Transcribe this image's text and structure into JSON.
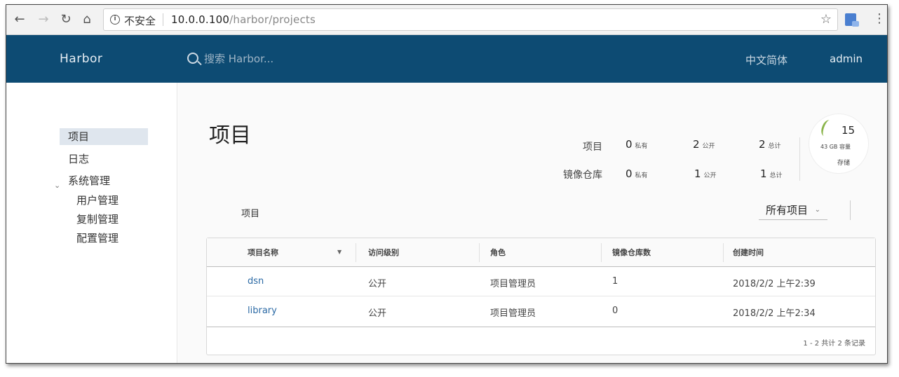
{
  "browser": {
    "insecure_label": "不安全",
    "url_host": "10.0.0.100",
    "url_path": "/harbor/projects"
  },
  "header": {
    "brand": "Harbor",
    "search_placeholder": "搜索 Harbor...",
    "language": "中文简体",
    "user": "admin",
    "bg_color": "#0d4b73"
  },
  "sidebar": {
    "items": [
      {
        "label": "项目",
        "active": true
      },
      {
        "label": "日志"
      },
      {
        "label": "系统管理",
        "expanded": true
      },
      {
        "label": "用户管理"
      },
      {
        "label": "复制管理"
      },
      {
        "label": "配置管理"
      }
    ]
  },
  "main": {
    "title": "项目",
    "stats": {
      "projects_label": "项目",
      "repos_label": "镜像仓库",
      "projects": {
        "private": "0",
        "public": "2",
        "total": "2"
      },
      "repos": {
        "private": "0",
        "public": "1",
        "total": "1"
      },
      "private_unit": "私有",
      "public_unit": "公开",
      "total_unit": "总计"
    },
    "storage": {
      "count": "15",
      "size": "43 GB 容量",
      "label": "存储",
      "accent_color": "#8ab44a"
    },
    "subtitle": "项目",
    "filter": {
      "selected": "所有项目"
    }
  },
  "table": {
    "columns": [
      "项目名称",
      "访问级别",
      "角色",
      "镜像仓库数",
      "创建时间"
    ],
    "rows": [
      {
        "name": "dsn",
        "access": "公开",
        "role": "项目管理员",
        "repos": "1",
        "created": "2018/2/2 上午2:39"
      },
      {
        "name": "library",
        "access": "公开",
        "role": "项目管理员",
        "repos": "0",
        "created": "2018/2/2 上午2:34"
      }
    ],
    "footer": "1 - 2 共计 2 条记录"
  }
}
